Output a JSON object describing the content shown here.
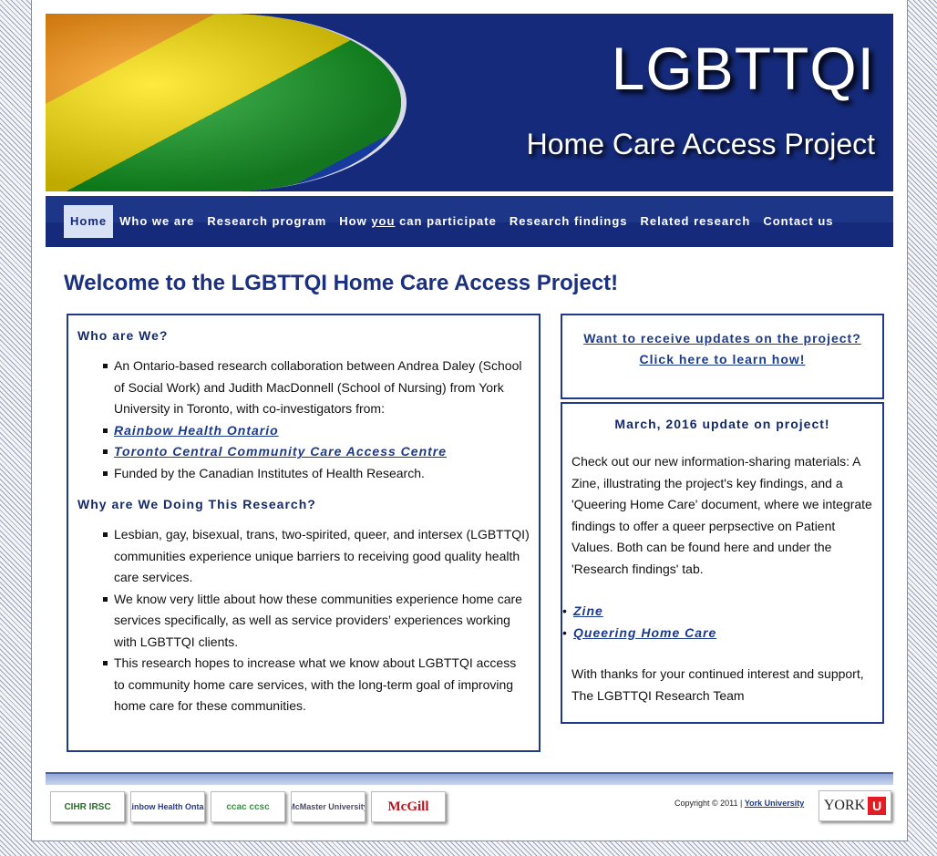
{
  "banner": {
    "title": "LGBTTQI",
    "subtitle": "Home Care Access Project"
  },
  "nav": {
    "items": [
      {
        "label": "Home"
      },
      {
        "label": "Who we are"
      },
      {
        "label": "Research program"
      },
      {
        "label_pre": "How ",
        "label_u": "you",
        "label_post": " can participate"
      },
      {
        "label": "Research findings"
      },
      {
        "label": "Related research"
      },
      {
        "label": "Contact us"
      }
    ]
  },
  "main": {
    "heading": "Welcome to the LGBTTQI Home Care Access Project!",
    "who": {
      "heading": "Who are We?",
      "items": [
        "An Ontario-based research collaboration between Andrea Daley (School of Social Work) and Judith MacDonnell (School of Nursing) from York University in Toronto, with co-investigators from:",
        "Funded by the Canadian Institutes of Health Research."
      ],
      "links": [
        "Rainbow Health Ontario",
        "Toronto Central Community Care Access Centre"
      ]
    },
    "why": {
      "heading": "Why are We Doing This Research?",
      "items": [
        "Lesbian, gay, bisexual, trans, two-spirited, queer, and intersex (LGBTTQI) communities experience unique barriers to receiving good quality health care services.",
        "We know very little about how these communities experience home care services specifically, as well as service providers’ experiences working with LGBTTQI clients.",
        "This research hopes to increase what we know about LGBTTQI access to community home care services, with the long-term goal of improving home care for these communities."
      ]
    },
    "updates": {
      "line1": "Want to receive updates on the project?",
      "line2": "Click here to learn how!"
    },
    "news": {
      "heading": "March, 2016 update on project!",
      "body": "Check out our new information-sharing materials: A Zine, illustrating the project's key findings, and a 'Queering Home Care' document, where we integrate findings to offer a queer perpsective on Patient Values. Both can be found here and under the 'Research findings' tab.",
      "links": [
        "Zine",
        "Queering Home Care"
      ],
      "closing": "With thanks for your continued interest and support, The LGBTTQI Research Team"
    }
  },
  "footer": {
    "logos": [
      "CIHR IRSC",
      "Rainbow Health Ontario",
      "ccac ccsc",
      "McMaster University",
      "McGill"
    ],
    "copyright": "Copyright © 2011 | ",
    "copyright_link": "York University",
    "york_text": "YORK",
    "york_mark": "U"
  }
}
